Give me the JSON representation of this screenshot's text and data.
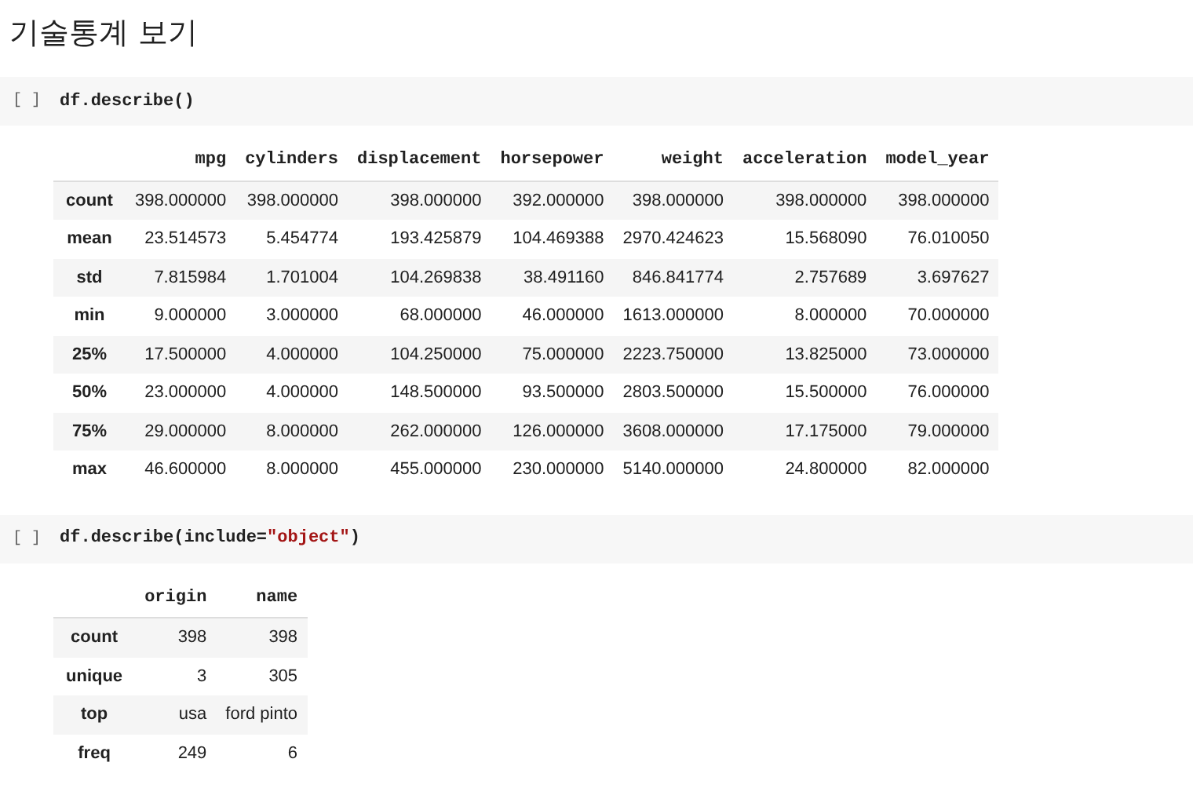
{
  "heading": "기술통계 보기",
  "cells": [
    {
      "prompt": "[ ]",
      "code": [
        {
          "text": "df.describe()",
          "kind": "plain"
        }
      ],
      "table": {
        "columns": [
          "mpg",
          "cylinders",
          "displacement",
          "horsepower",
          "weight",
          "acceleration",
          "model_year"
        ],
        "rows": [
          {
            "label": "count",
            "values": [
              "398.000000",
              "398.000000",
              "398.000000",
              "392.000000",
              "398.000000",
              "398.000000",
              "398.000000"
            ]
          },
          {
            "label": "mean",
            "values": [
              "23.514573",
              "5.454774",
              "193.425879",
              "104.469388",
              "2970.424623",
              "15.568090",
              "76.010050"
            ]
          },
          {
            "label": "std",
            "values": [
              "7.815984",
              "1.701004",
              "104.269838",
              "38.491160",
              "846.841774",
              "2.757689",
              "3.697627"
            ]
          },
          {
            "label": "min",
            "values": [
              "9.000000",
              "3.000000",
              "68.000000",
              "46.000000",
              "1613.000000",
              "8.000000",
              "70.000000"
            ]
          },
          {
            "label": "25%",
            "values": [
              "17.500000",
              "4.000000",
              "104.250000",
              "75.000000",
              "2223.750000",
              "13.825000",
              "73.000000"
            ]
          },
          {
            "label": "50%",
            "values": [
              "23.000000",
              "4.000000",
              "148.500000",
              "93.500000",
              "2803.500000",
              "15.500000",
              "76.000000"
            ]
          },
          {
            "label": "75%",
            "values": [
              "29.000000",
              "8.000000",
              "262.000000",
              "126.000000",
              "3608.000000",
              "17.175000",
              "79.000000"
            ]
          },
          {
            "label": "max",
            "values": [
              "46.600000",
              "8.000000",
              "455.000000",
              "230.000000",
              "5140.000000",
              "24.800000",
              "82.000000"
            ]
          }
        ]
      }
    },
    {
      "prompt": "[ ]",
      "code": [
        {
          "text": "df.describe(include=",
          "kind": "plain"
        },
        {
          "text": "\"object\"",
          "kind": "string"
        },
        {
          "text": ")",
          "kind": "plain"
        }
      ],
      "table": {
        "columns": [
          "origin",
          "name"
        ],
        "rows": [
          {
            "label": "count",
            "values": [
              "398",
              "398"
            ]
          },
          {
            "label": "unique",
            "values": [
              "3",
              "305"
            ]
          },
          {
            "label": "top",
            "values": [
              "usa",
              "ford pinto"
            ]
          },
          {
            "label": "freq",
            "values": [
              "249",
              "6"
            ]
          }
        ]
      }
    }
  ]
}
